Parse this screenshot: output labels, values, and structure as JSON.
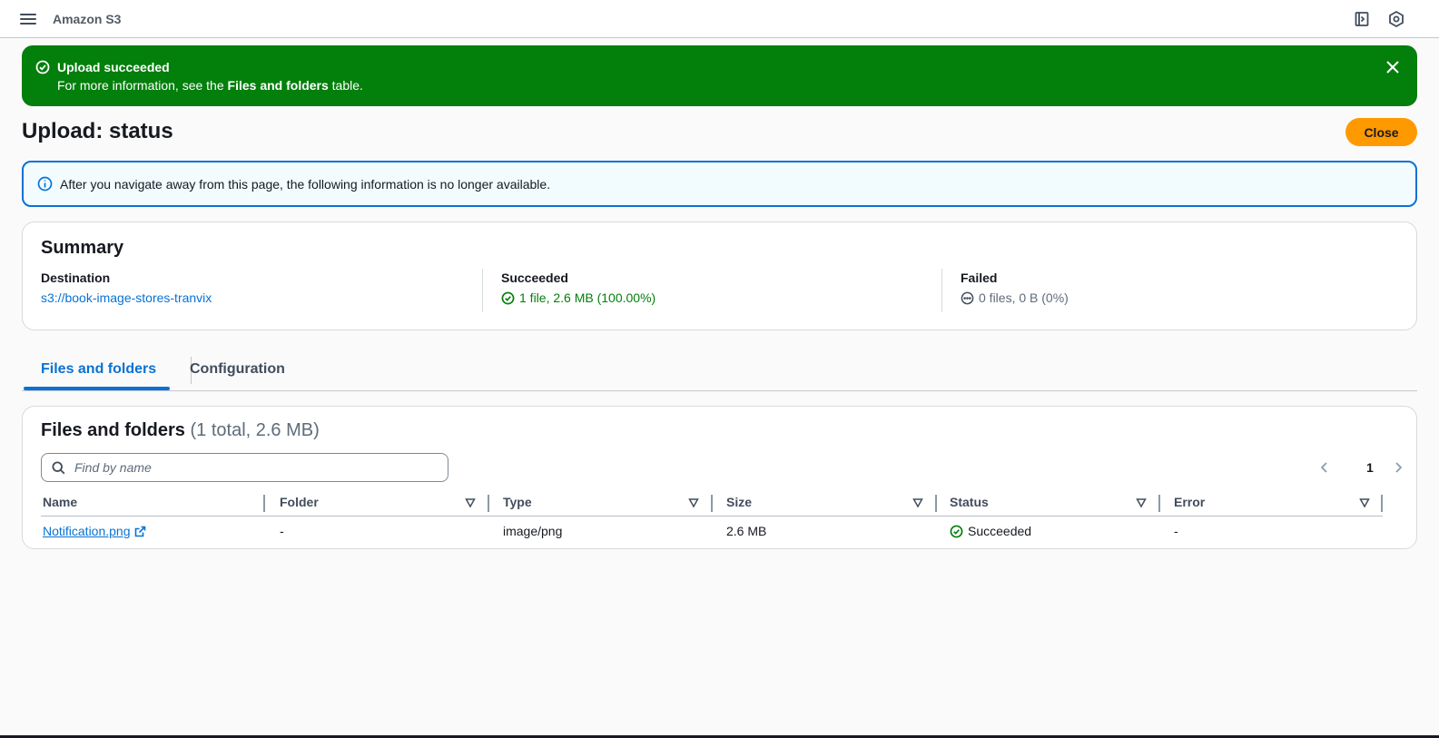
{
  "topbar": {
    "menu_icon": "hamburger-menu-icon",
    "service_name": "Amazon S3",
    "icons": [
      "notepad-icon",
      "settings-hex-icon"
    ]
  },
  "flash": {
    "title": "Upload succeeded",
    "body_prefix": "For more information, see the ",
    "body_bold": "Files and folders",
    "body_suffix": " table.",
    "color": "#037f0c"
  },
  "page": {
    "title": "Upload: status",
    "close_label": "Close"
  },
  "info": {
    "text": "After you navigate away from this page, the following information is no longer available."
  },
  "summary": {
    "title": "Summary",
    "destination": {
      "label": "Destination",
      "value": "s3://book-image-stores-tranvix"
    },
    "succeeded": {
      "label": "Succeeded",
      "value": "1 file, 2.6 MB (100.00%)"
    },
    "failed": {
      "label": "Failed",
      "value": "0 files, 0 B (0%)"
    }
  },
  "tabs": [
    {
      "label": "Files and folders",
      "active": true
    },
    {
      "label": "Configuration",
      "active": false
    }
  ],
  "files": {
    "title": "Files and folders",
    "count": "(1 total, 2.6 MB)",
    "search_placeholder": "Find by name",
    "page": "1",
    "columns": [
      "Name",
      "Folder",
      "Type",
      "Size",
      "Status",
      "Error"
    ],
    "rows": [
      {
        "name": "Notification.png",
        "folder": "-",
        "type": "image/png",
        "size": "2.6 MB",
        "status": "Succeeded",
        "error": "-"
      }
    ]
  },
  "colors": {
    "accent": "#0972d3",
    "success": "#037f0c",
    "primary_button": "#ff9900"
  }
}
